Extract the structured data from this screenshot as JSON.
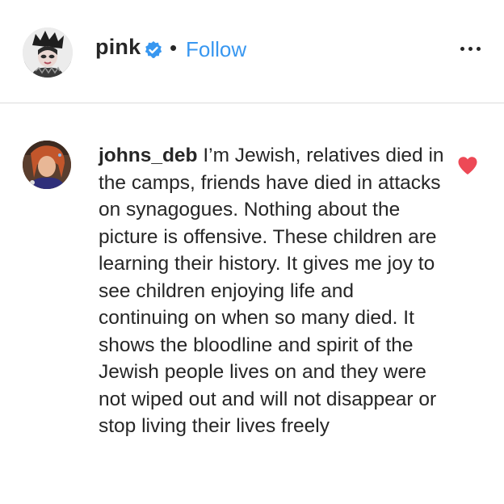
{
  "post_header": {
    "username": "pink",
    "separator": "•",
    "follow_label": "Follow",
    "verified_icon": "verified-badge-icon",
    "more_icon": "more-options-icon"
  },
  "comment": {
    "author": "johns_deb",
    "text": "I’m Jewish, relatives died in the camps, friends have died in attacks on synagogues. Nothing about the picture is offensive. These children are learning their history. It gives me joy to see children enjoying life and continuing on when so many died. It shows the bloodline and spirit of the Jewish people lives on and they were not wiped out and will not disappear or stop living their lives freely",
    "like_icon": "heart-icon",
    "liked": true
  },
  "colors": {
    "accent": "#3897f0",
    "heart": "#ed4956",
    "text": "#262626",
    "divider": "#dbdbdb"
  }
}
